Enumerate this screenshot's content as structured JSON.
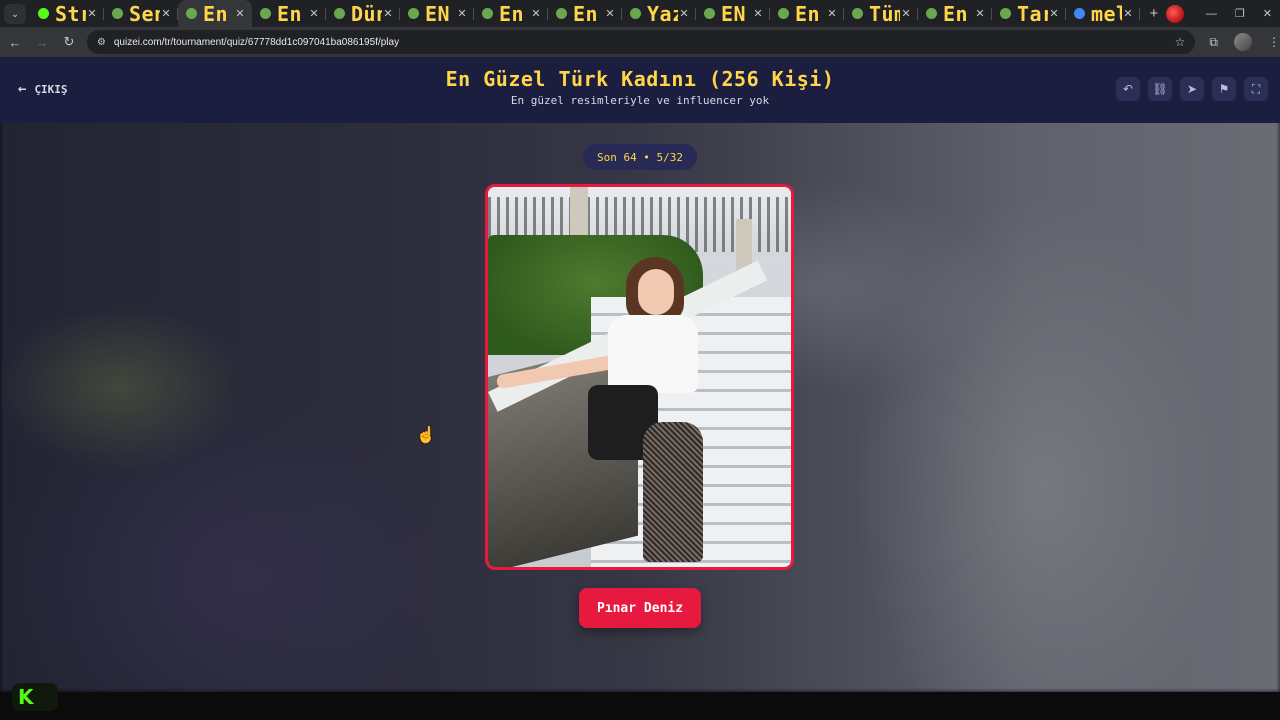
{
  "browser": {
    "tabs": [
      {
        "title": "Stream",
        "fav": "#53fc18",
        "active": false
      },
      {
        "title": "Senin H",
        "fav": "#6aa84f",
        "active": false
      },
      {
        "title": "En Güz",
        "fav": "#6aa84f",
        "active": true
      },
      {
        "title": "En Güz",
        "fav": "#6aa84f",
        "active": false
      },
      {
        "title": "Dünya",
        "fav": "#6aa84f",
        "active": false
      },
      {
        "title": "EN GÜ",
        "fav": "#6aa84f",
        "active": false
      },
      {
        "title": "En güz",
        "fav": "#6aa84f",
        "active": false
      },
      {
        "title": "En İyi V",
        "fav": "#6aa84f",
        "active": false
      },
      {
        "title": "Yaz His",
        "fav": "#6aa84f",
        "active": false
      },
      {
        "title": "EN İYİ",
        "fav": "#6aa84f",
        "active": false
      },
      {
        "title": "En iyi T",
        "fav": "#6aa84f",
        "active": false
      },
      {
        "title": "Tüm Za",
        "fav": "#6aa84f",
        "active": false
      },
      {
        "title": "En İyi E",
        "fav": "#6aa84f",
        "active": false
      },
      {
        "title": "Tarihin",
        "fav": "#6aa84f",
        "active": false
      },
      {
        "title": "melis s",
        "fav": "#4285f4",
        "active": false
      }
    ],
    "url": "quizei.com/tr/tournament/quiz/67778dd1c097041ba086195f/play"
  },
  "header": {
    "exit_label": "ÇIKIŞ",
    "title": "En Güzel Türk Kadını (256 Kişi)",
    "subtitle": "En güzel resimleriyle ve influencer yok"
  },
  "round": {
    "label": "Son 64 • 5/32"
  },
  "candidate": {
    "name": "Pınar Deniz"
  },
  "colors": {
    "accent_red": "#e8193e",
    "title_yellow": "#ffd54a",
    "header_bg": "#1c1e3f"
  }
}
